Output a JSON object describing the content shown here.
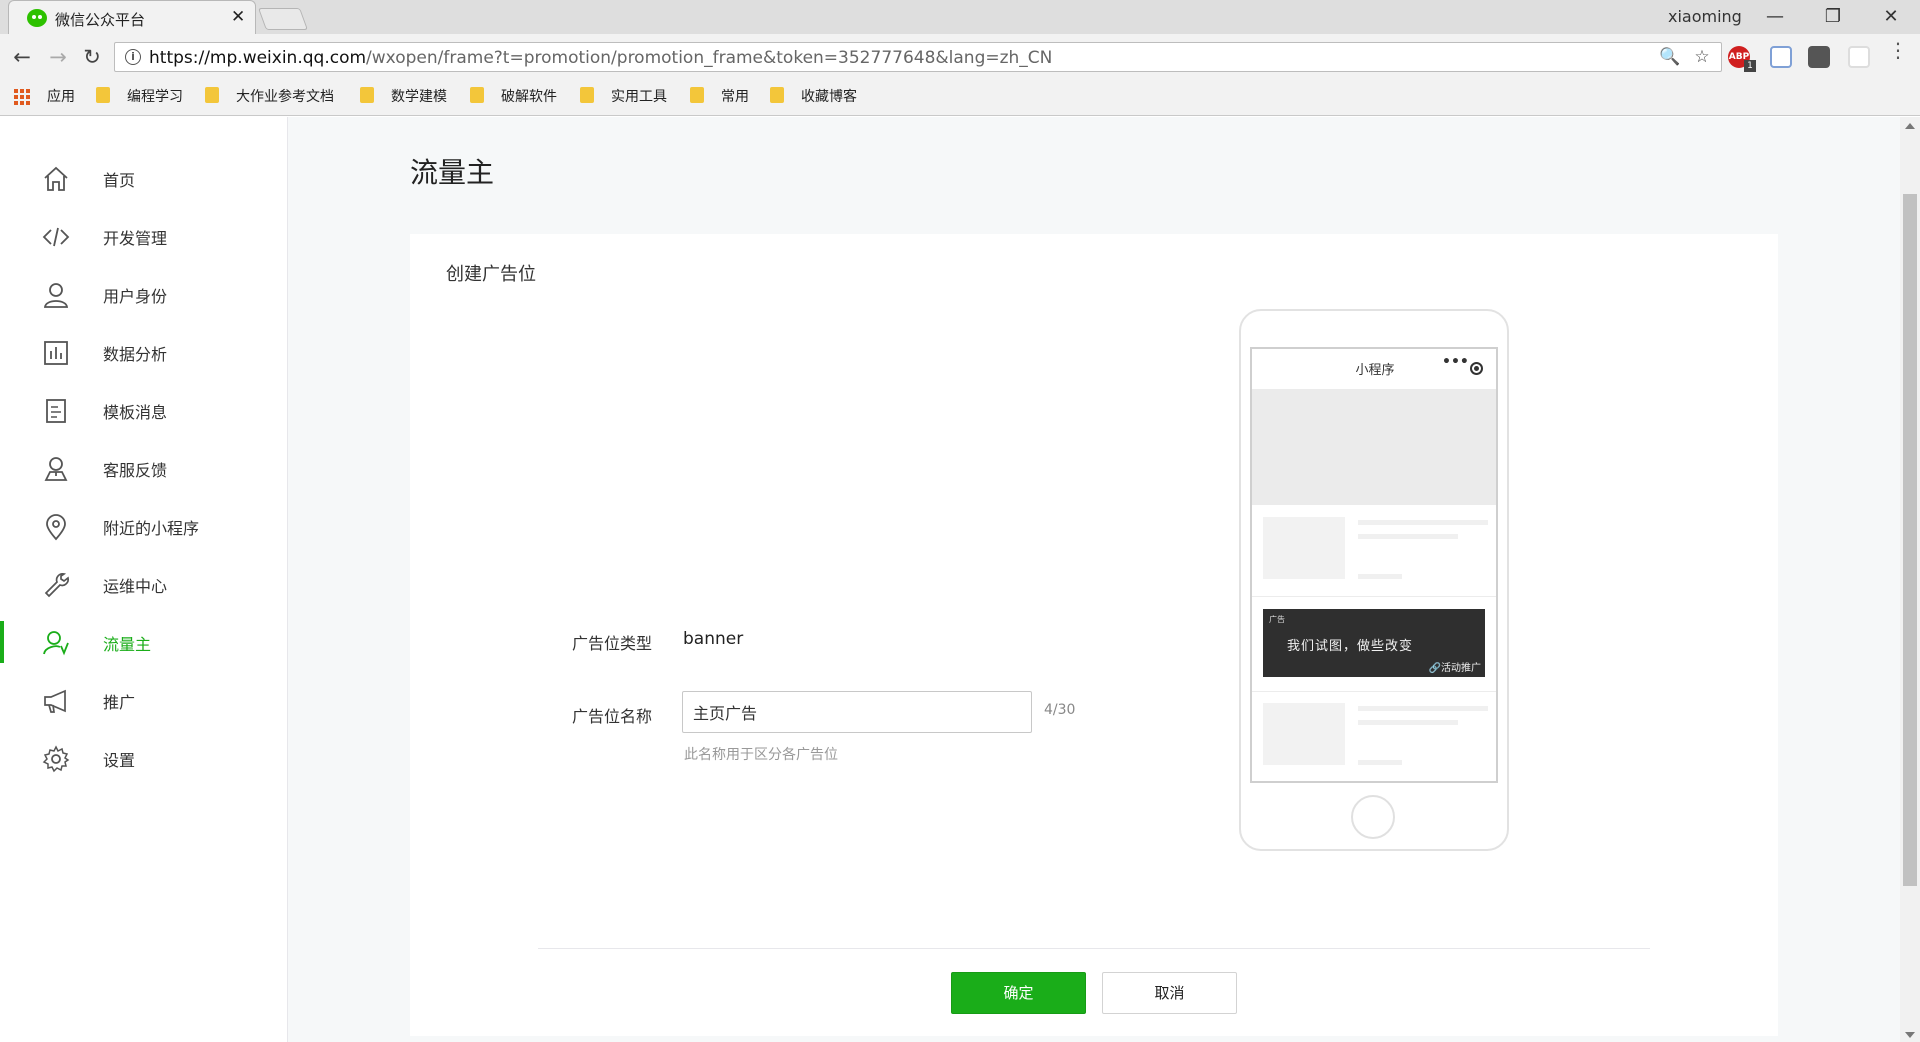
{
  "browser": {
    "tab_title": "微信公众平台",
    "tab_close": "✕",
    "user": "xiaoming",
    "win_minimize": "—",
    "win_restore": "❐",
    "win_close": "✕",
    "back": "←",
    "forward": "→",
    "reload": "↻",
    "url_host": "https://mp.weixin.qq.com",
    "url_path": "/wxopen/frame?t=promotion/promotion_frame&token=352777648&lang=zh_CN",
    "zoom_icon": "🔍",
    "star_icon": "☆",
    "ext_abp": "ABP",
    "ext_abp_badge": "1",
    "bookmarks": [
      "应用",
      "编程学习",
      "大作业参考文档",
      "数学建模",
      "破解软件",
      "实用工具",
      "常用",
      "收藏博客"
    ]
  },
  "sidebar": {
    "items": [
      {
        "label": "首页",
        "icon": "home-icon"
      },
      {
        "label": "开发管理",
        "icon": "code-icon"
      },
      {
        "label": "用户身份",
        "icon": "user-icon"
      },
      {
        "label": "数据分析",
        "icon": "chart-icon"
      },
      {
        "label": "模板消息",
        "icon": "document-icon"
      },
      {
        "label": "客服反馈",
        "icon": "service-icon"
      },
      {
        "label": "附近的小程序",
        "icon": "location-icon"
      },
      {
        "label": "运维中心",
        "icon": "wrench-icon"
      },
      {
        "label": "流量主",
        "icon": "traffic-owner-icon",
        "active": true
      },
      {
        "label": "推广",
        "icon": "megaphone-icon"
      },
      {
        "label": "设置",
        "icon": "gear-icon"
      }
    ],
    "active_color": "#1aad19"
  },
  "main": {
    "page_title": "流量主",
    "card_title": "创建广告位",
    "type_label": "广告位类型",
    "type_value": "banner",
    "name_label": "广告位名称",
    "name_value": "主页广告",
    "name_counter": "4/30",
    "name_hint": "此名称用于区分各广告位",
    "confirm_label": "确定",
    "cancel_label": "取消"
  },
  "preview": {
    "app_title": "小程序",
    "menu_dots": "•••",
    "ad_tag": "广告",
    "ad_text": "我们试图，做些改变",
    "ad_link": "🔗活动推广"
  }
}
